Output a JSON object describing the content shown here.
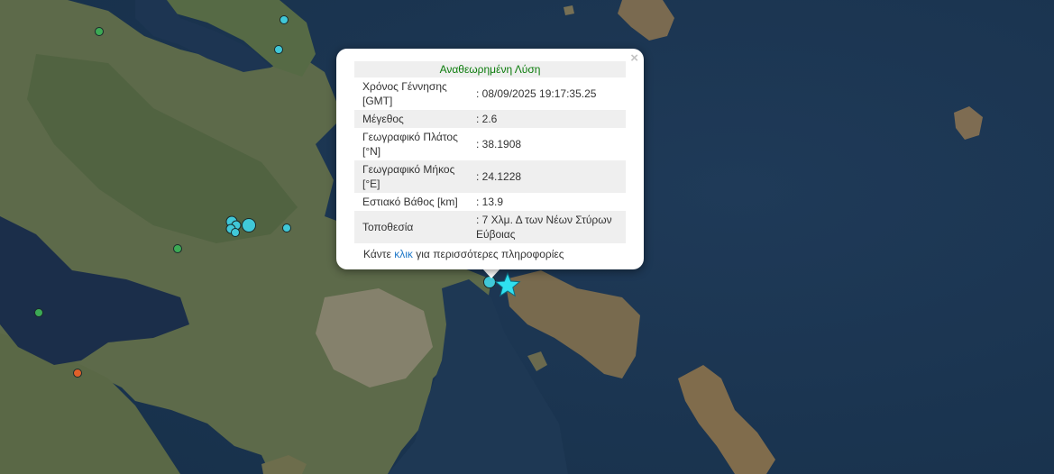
{
  "popup": {
    "header": "Αναθεωρημένη Λύση",
    "close": "×",
    "rows": [
      {
        "label": "Χρόνος Γέννησης [GMT]",
        "value": ": 08/09/2025 19:17:35.25"
      },
      {
        "label": "Μέγεθος",
        "value": ": 2.6"
      },
      {
        "label": "Γεωγραφικό Πλάτος [°N]",
        "value": ": 38.1908"
      },
      {
        "label": "Γεωγραφικό Μήκος [°E]",
        "value": ": 24.1228"
      },
      {
        "label": "Εστιακό Βάθος [km]",
        "value": ": 13.9"
      },
      {
        "label": "Τοποθεσία",
        "value": ": 7 Χλμ. Δ των Νέων Στύρων Εύβοιας"
      }
    ],
    "more_prefix": "Κάντε",
    "more_link": "κλικ",
    "more_suffix": "για περισσότερες πληροφορίες"
  },
  "markers": {
    "colors": {
      "cyan": "#40c8d8",
      "green": "#3caa55",
      "orange": "#e0602a",
      "star": "#2fe0f0"
    }
  }
}
